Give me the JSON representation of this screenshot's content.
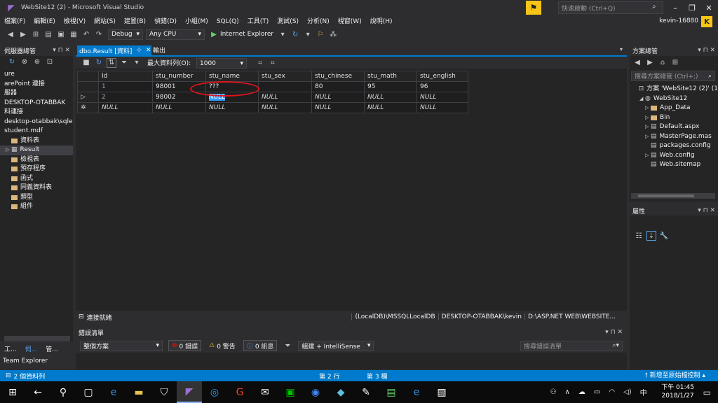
{
  "window": {
    "title": "WebSite12 (2) - Microsoft Visual Studio",
    "quick_launch_placeholder": "快速啟動 (Ctrl+Q)",
    "user": "kevin-16880",
    "user_initial": "K"
  },
  "menu": [
    "檔案(F)",
    "編輯(E)",
    "檢視(V)",
    "網站(S)",
    "建置(B)",
    "偵錯(D)",
    "小組(M)",
    "SQL(Q)",
    "工具(T)",
    "測試(S)",
    "分析(N)",
    "視窗(W)",
    "說明(H)"
  ],
  "toolbar": {
    "config": "Debug",
    "platform": "Any CPU",
    "run_target": "Internet Explorer"
  },
  "server_explorer": {
    "title": "伺服器總管",
    "items": [
      {
        "label": "ure",
        "kind": "text"
      },
      {
        "label": "arePoint 連接",
        "kind": "text"
      },
      {
        "label": "服器",
        "kind": "text"
      },
      {
        "label": "DESKTOP-OTABBAK",
        "kind": "text"
      },
      {
        "label": "料連接",
        "kind": "text"
      },
      {
        "label": "desktop-otabbak\\sqle",
        "kind": "text"
      },
      {
        "label": "student.mdf",
        "kind": "text"
      },
      {
        "label": "資料表",
        "kind": "folder"
      },
      {
        "label": "Result",
        "kind": "table"
      },
      {
        "label": "檢視表",
        "kind": "folder"
      },
      {
        "label": "預存程序",
        "kind": "folder"
      },
      {
        "label": "函式",
        "kind": "folder"
      },
      {
        "label": "同義資料表",
        "kind": "folder"
      },
      {
        "label": "類型",
        "kind": "folder"
      },
      {
        "label": "組件",
        "kind": "folder"
      }
    ]
  },
  "editor": {
    "active_tab": "dbo.Result [資料]",
    "output_tab": "輸出",
    "max_rows_label": "最大資料列(O):",
    "max_rows_value": "1000"
  },
  "grid": {
    "columns": [
      "Id",
      "stu_number",
      "stu_name",
      "stu_sex",
      "stu_chinese",
      "stu_math",
      "stu_english"
    ],
    "rows": [
      {
        "marker": "",
        "cells": [
          "1",
          "98001",
          "???",
          "",
          "80",
          "95",
          "96"
        ]
      },
      {
        "marker": "▷",
        "cells": [
          "2",
          "98002",
          "NULL",
          "NULL",
          "NULL",
          "NULL",
          "NULL"
        ]
      },
      {
        "marker": "✲",
        "cells": [
          "NULL",
          "NULL",
          "NULL",
          "NULL",
          "NULL",
          "NULL",
          "NULL"
        ]
      }
    ]
  },
  "editor_status": {
    "connection": "連接就緒",
    "server": "(LocalDB)\\MSSQLLocalDB",
    "user": "DESKTOP-OTABBAK\\kevin",
    "path": "D:\\ASP.NET WEB\\WEBSITE..."
  },
  "error_list": {
    "title": "錯誤清單",
    "scope": "整個方案",
    "errors": "0 錯誤",
    "warnings": "0 警告",
    "messages": "0 訊息",
    "build_filter": "組建 + IntelliSense",
    "search_placeholder": "搜尋錯誤清單"
  },
  "solution_explorer": {
    "title": "方案總管",
    "search_placeholder": "搜尋方案總管 (Ctrl+;)",
    "items": [
      {
        "label": "方案 'WebSite12 (2)' (1",
        "indent": 0,
        "icon": "solution-icon"
      },
      {
        "label": "WebSite12",
        "indent": 1,
        "icon": "globe-icon"
      },
      {
        "label": "App_Data",
        "indent": 2,
        "icon": "folder-icon"
      },
      {
        "label": "Bin",
        "indent": 2,
        "icon": "folder-icon"
      },
      {
        "label": "Default.aspx",
        "indent": 2,
        "icon": "file-icon"
      },
      {
        "label": "MasterPage.mas",
        "indent": 2,
        "icon": "file-icon"
      },
      {
        "label": "packages.config",
        "indent": 2,
        "icon": "file-icon"
      },
      {
        "label": "Web.config",
        "indent": 2,
        "icon": "config-icon"
      },
      {
        "label": "Web.sitemap",
        "indent": 2,
        "icon": "sitemap-icon"
      }
    ]
  },
  "properties": {
    "title": "屬性"
  },
  "bottom_tabs": [
    "工...",
    "伺...",
    "管..."
  ],
  "team_explorer": "Team Explorer",
  "status": {
    "left": "2 個資料列",
    "line": "第 2 行",
    "col": "第 3 欄",
    "right": "新增至原始檔控制"
  },
  "clock": {
    "time": "下午 01:45",
    "date": "2018/1/27"
  },
  "tray_ime": "中"
}
